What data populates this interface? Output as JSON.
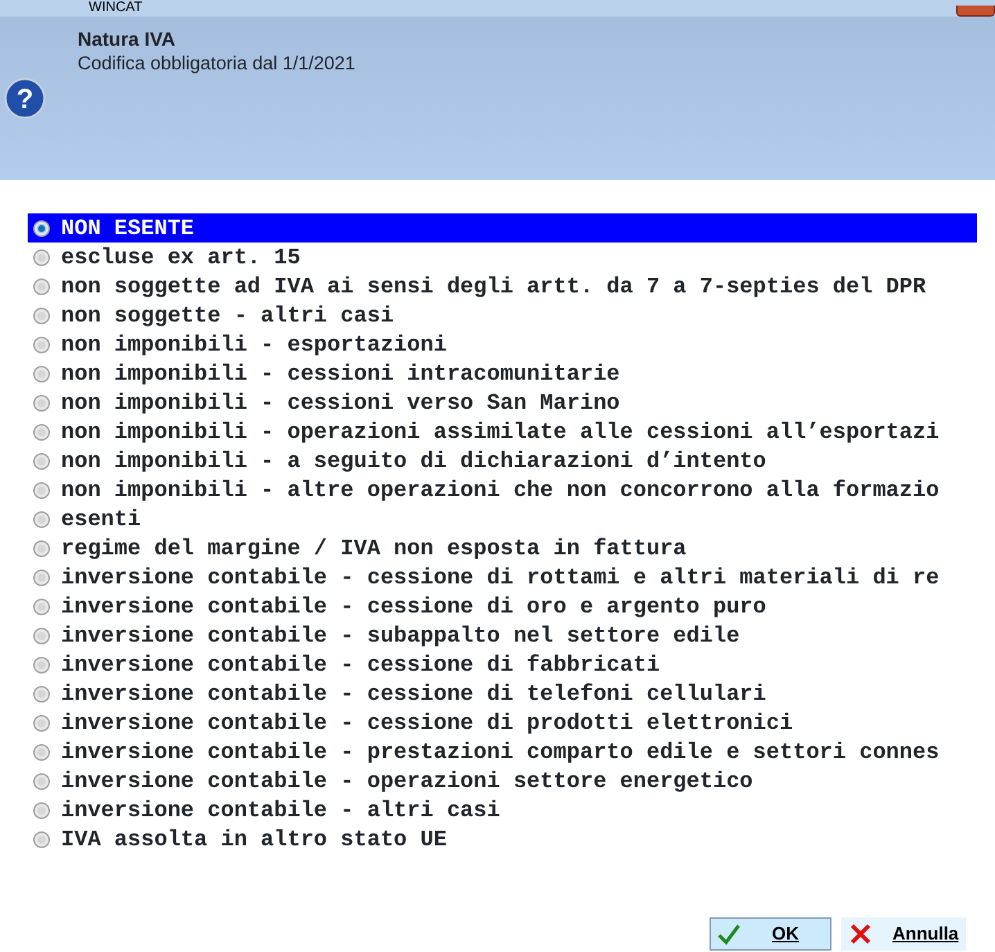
{
  "window": {
    "title": "WINCAT"
  },
  "header": {
    "help_icon_glyph": "?",
    "title": "Natura IVA",
    "subtitle": "Codifica obbligatoria dal 1/1/2021"
  },
  "options": [
    {
      "label": "NON ESENTE",
      "selected": true
    },
    {
      "label": "escluse ex art. 15",
      "selected": false
    },
    {
      "label": "non soggette ad IVA ai sensi degli artt. da 7 a 7-septies del DPR",
      "selected": false
    },
    {
      "label": "non soggette - altri casi",
      "selected": false
    },
    {
      "label": "non imponibili - esportazioni",
      "selected": false
    },
    {
      "label": "non imponibili - cessioni intracomunitarie",
      "selected": false
    },
    {
      "label": "non imponibili - cessioni verso San Marino",
      "selected": false
    },
    {
      "label": "non imponibili - operazioni assimilate alle cessioni all’esportazi",
      "selected": false
    },
    {
      "label": "non imponibili - a seguito di dichiarazioni d’intento",
      "selected": false
    },
    {
      "label": "non imponibili - altre operazioni che non concorrono alla formazio",
      "selected": false
    },
    {
      "label": "esenti",
      "selected": false
    },
    {
      "label": "regime del margine / IVA non esposta in fattura",
      "selected": false
    },
    {
      "label": "inversione contabile - cessione di rottami e altri materiali di re",
      "selected": false
    },
    {
      "label": "inversione contabile - cessione di oro e argento puro",
      "selected": false
    },
    {
      "label": "inversione contabile - subappalto nel settore edile",
      "selected": false
    },
    {
      "label": "inversione contabile - cessione di fabbricati",
      "selected": false
    },
    {
      "label": "inversione contabile - cessione di telefoni cellulari",
      "selected": false
    },
    {
      "label": "inversione contabile - cessione di prodotti elettronici",
      "selected": false
    },
    {
      "label": "inversione contabile - prestazioni comparto edile e settori connes",
      "selected": false
    },
    {
      "label": "inversione contabile - operazioni settore energetico",
      "selected": false
    },
    {
      "label": "inversione contabile - altri casi",
      "selected": false
    },
    {
      "label": "IVA assolta in altro stato UE",
      "selected": false
    }
  ],
  "buttons": [
    {
      "kind": "ok",
      "label": "OK"
    },
    {
      "kind": "cancel",
      "label": "Annulla"
    }
  ]
}
